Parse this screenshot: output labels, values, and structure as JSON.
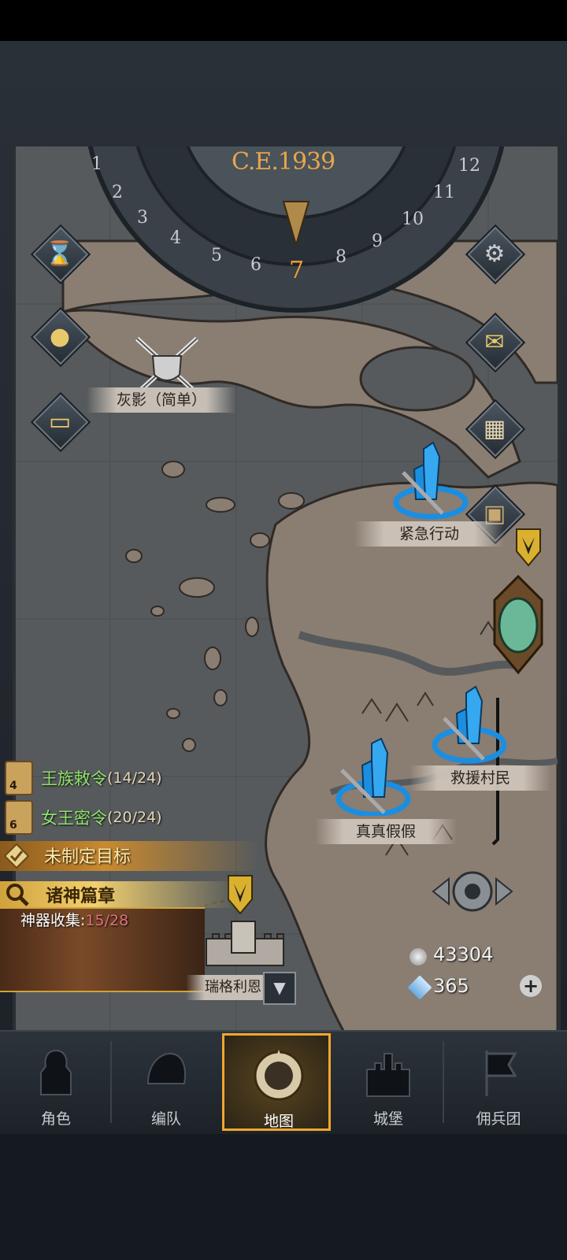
{
  "calendar": {
    "year": "C.E.1939",
    "months": [
      "1",
      "2",
      "3",
      "4",
      "5",
      "6",
      "7",
      "8",
      "9",
      "10",
      "11",
      "12"
    ],
    "current_month": "7"
  },
  "map_locations": [
    {
      "name": "灰影（简单）"
    },
    {
      "name": "紧急行动"
    },
    {
      "name": "救援村民"
    },
    {
      "name": "真真假假"
    },
    {
      "name": "瑞格利恩"
    }
  ],
  "quests": [
    {
      "badge": "4",
      "title": "王族敕令",
      "progress": "(14/24)"
    },
    {
      "badge": "6",
      "title": "女王密令",
      "progress": "(20/24)"
    }
  ],
  "goal": {
    "text": "未制定目标"
  },
  "gods": {
    "text": "诸神篇章"
  },
  "artifact": {
    "label": "神器收集:",
    "value": "15/28"
  },
  "resources": {
    "silver": "43304",
    "crystal": "365"
  },
  "nav": [
    {
      "label": "角色",
      "active": false
    },
    {
      "label": "编队",
      "active": false
    },
    {
      "label": "地图",
      "active": true
    },
    {
      "label": "城堡",
      "active": false
    },
    {
      "label": "佣兵团",
      "active": false
    }
  ],
  "colors": {
    "accent": "#f0a630",
    "quest_green": "#8fe36a",
    "mission_blue": "#1c8ee0"
  }
}
